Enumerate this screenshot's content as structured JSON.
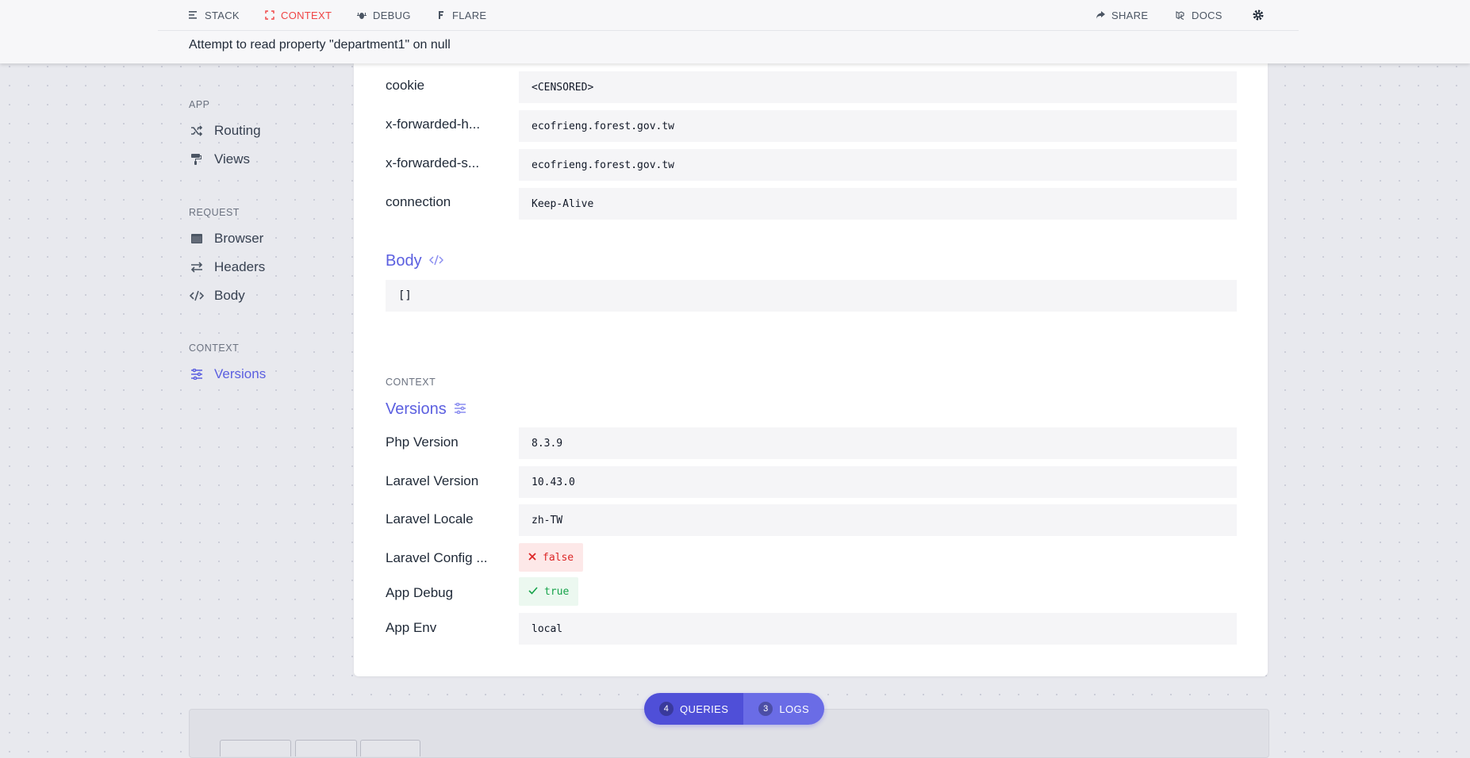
{
  "nav": {
    "stack": "STACK",
    "context": "CONTEXT",
    "debug": "DEBUG",
    "flare": "FLARE",
    "share": "SHARE",
    "docs": "DOCS"
  },
  "exception": {
    "title": "Attempt to read property \"department1\" on null"
  },
  "sidebar": {
    "app_heading": "APP",
    "app_items": [
      {
        "label": "Routing",
        "icon": "shuffle-icon"
      },
      {
        "label": "Views",
        "icon": "paint-roller-icon"
      }
    ],
    "request_heading": "REQUEST",
    "request_items": [
      {
        "label": "Browser",
        "icon": "window-icon"
      },
      {
        "label": "Headers",
        "icon": "exchange-icon"
      },
      {
        "label": "Body",
        "icon": "code-icon"
      }
    ],
    "context_heading": "CONTEXT",
    "context_items": [
      {
        "label": "Versions",
        "icon": "sliders-icon",
        "active": true
      }
    ]
  },
  "headers": [
    {
      "label": "cookie",
      "value": "<CENSORED>"
    },
    {
      "label": "x-forwarded-h...",
      "value": "ecofrieng.forest.gov.tw"
    },
    {
      "label": "x-forwarded-s...",
      "value": "ecofrieng.forest.gov.tw"
    },
    {
      "label": "connection",
      "value": "Keep-Alive"
    }
  ],
  "body_section": {
    "title": "Body",
    "value": "[]"
  },
  "versions_section": {
    "kicker": "CONTEXT",
    "title": "Versions",
    "rows": [
      {
        "label": "Php Version",
        "value": "8.3.9"
      },
      {
        "label": "Laravel Version",
        "value": "10.43.0"
      },
      {
        "label": "Laravel Locale",
        "value": "zh-TW"
      },
      {
        "label": "Laravel Config ...",
        "value": "false"
      },
      {
        "label": "App Debug",
        "value": "true"
      },
      {
        "label": "App Env",
        "value": "local"
      }
    ]
  },
  "bottom_bar": {
    "queries_count": "4",
    "queries_label": "QUERIES",
    "logs_count": "3",
    "logs_label": "LOGS"
  },
  "colors": {
    "accent": "#5b5fe0",
    "active_nav": "#ef4444",
    "false_badge": "#dc2626",
    "true_badge": "#16a34a"
  }
}
